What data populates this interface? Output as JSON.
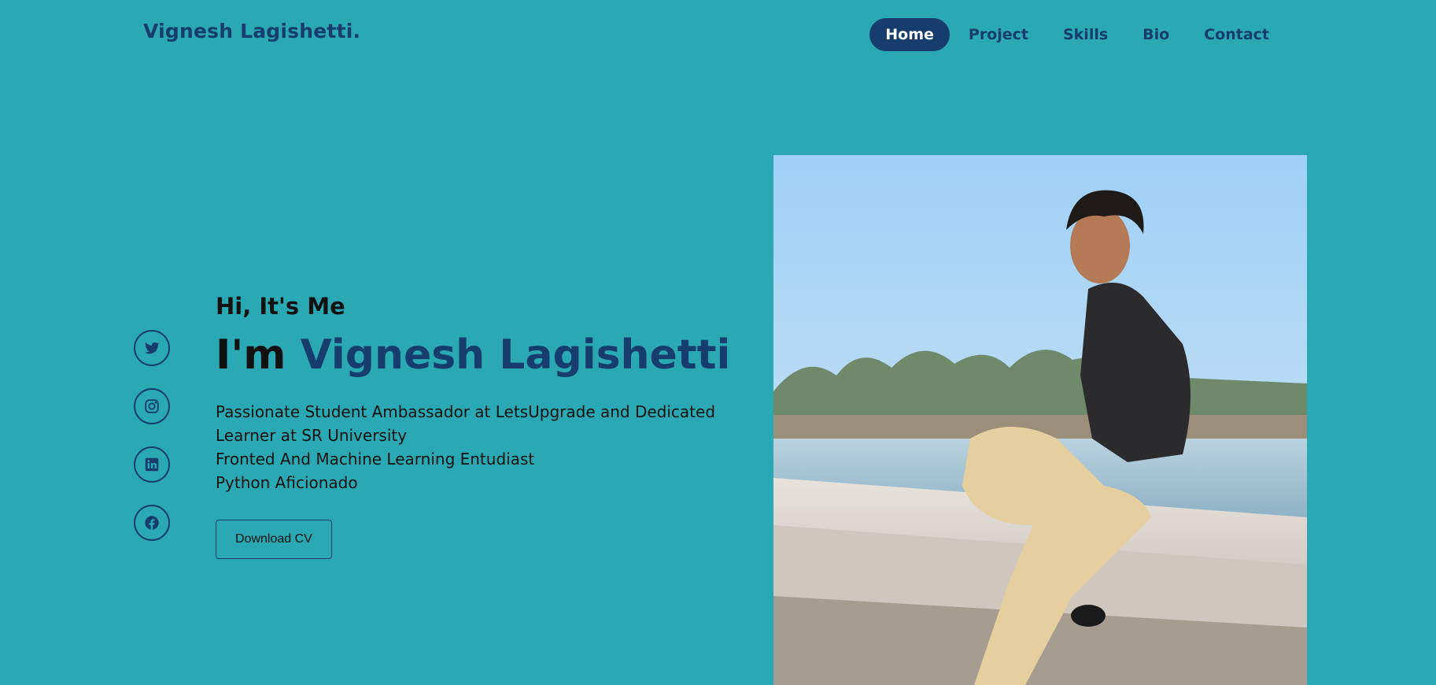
{
  "header": {
    "logo": "Vignesh Lagishetti.",
    "nav": [
      {
        "label": "Home",
        "active": true
      },
      {
        "label": "Project",
        "active": false
      },
      {
        "label": "Skills",
        "active": false
      },
      {
        "label": "Bio",
        "active": false
      },
      {
        "label": "Contact",
        "active": false
      }
    ]
  },
  "socials": [
    {
      "icon": "twitter-icon"
    },
    {
      "icon": "instagram-icon"
    },
    {
      "icon": "linkedin-icon"
    },
    {
      "icon": "facebook-icon"
    }
  ],
  "hero": {
    "greeting": "Hi, It's Me",
    "prefix": "I'm",
    "name": "Vignesh Lagishetti",
    "lines": [
      "Passionate Student Ambassador at LetsUpgrade and Dedicated Learner at SR University",
      "Fronted And Machine Learning Entudiast",
      "Python Aficionado"
    ],
    "cv_label": "Download CV"
  },
  "colors": {
    "background": "#2aa8b3",
    "accent": "#163d6e",
    "text": "#111111"
  }
}
